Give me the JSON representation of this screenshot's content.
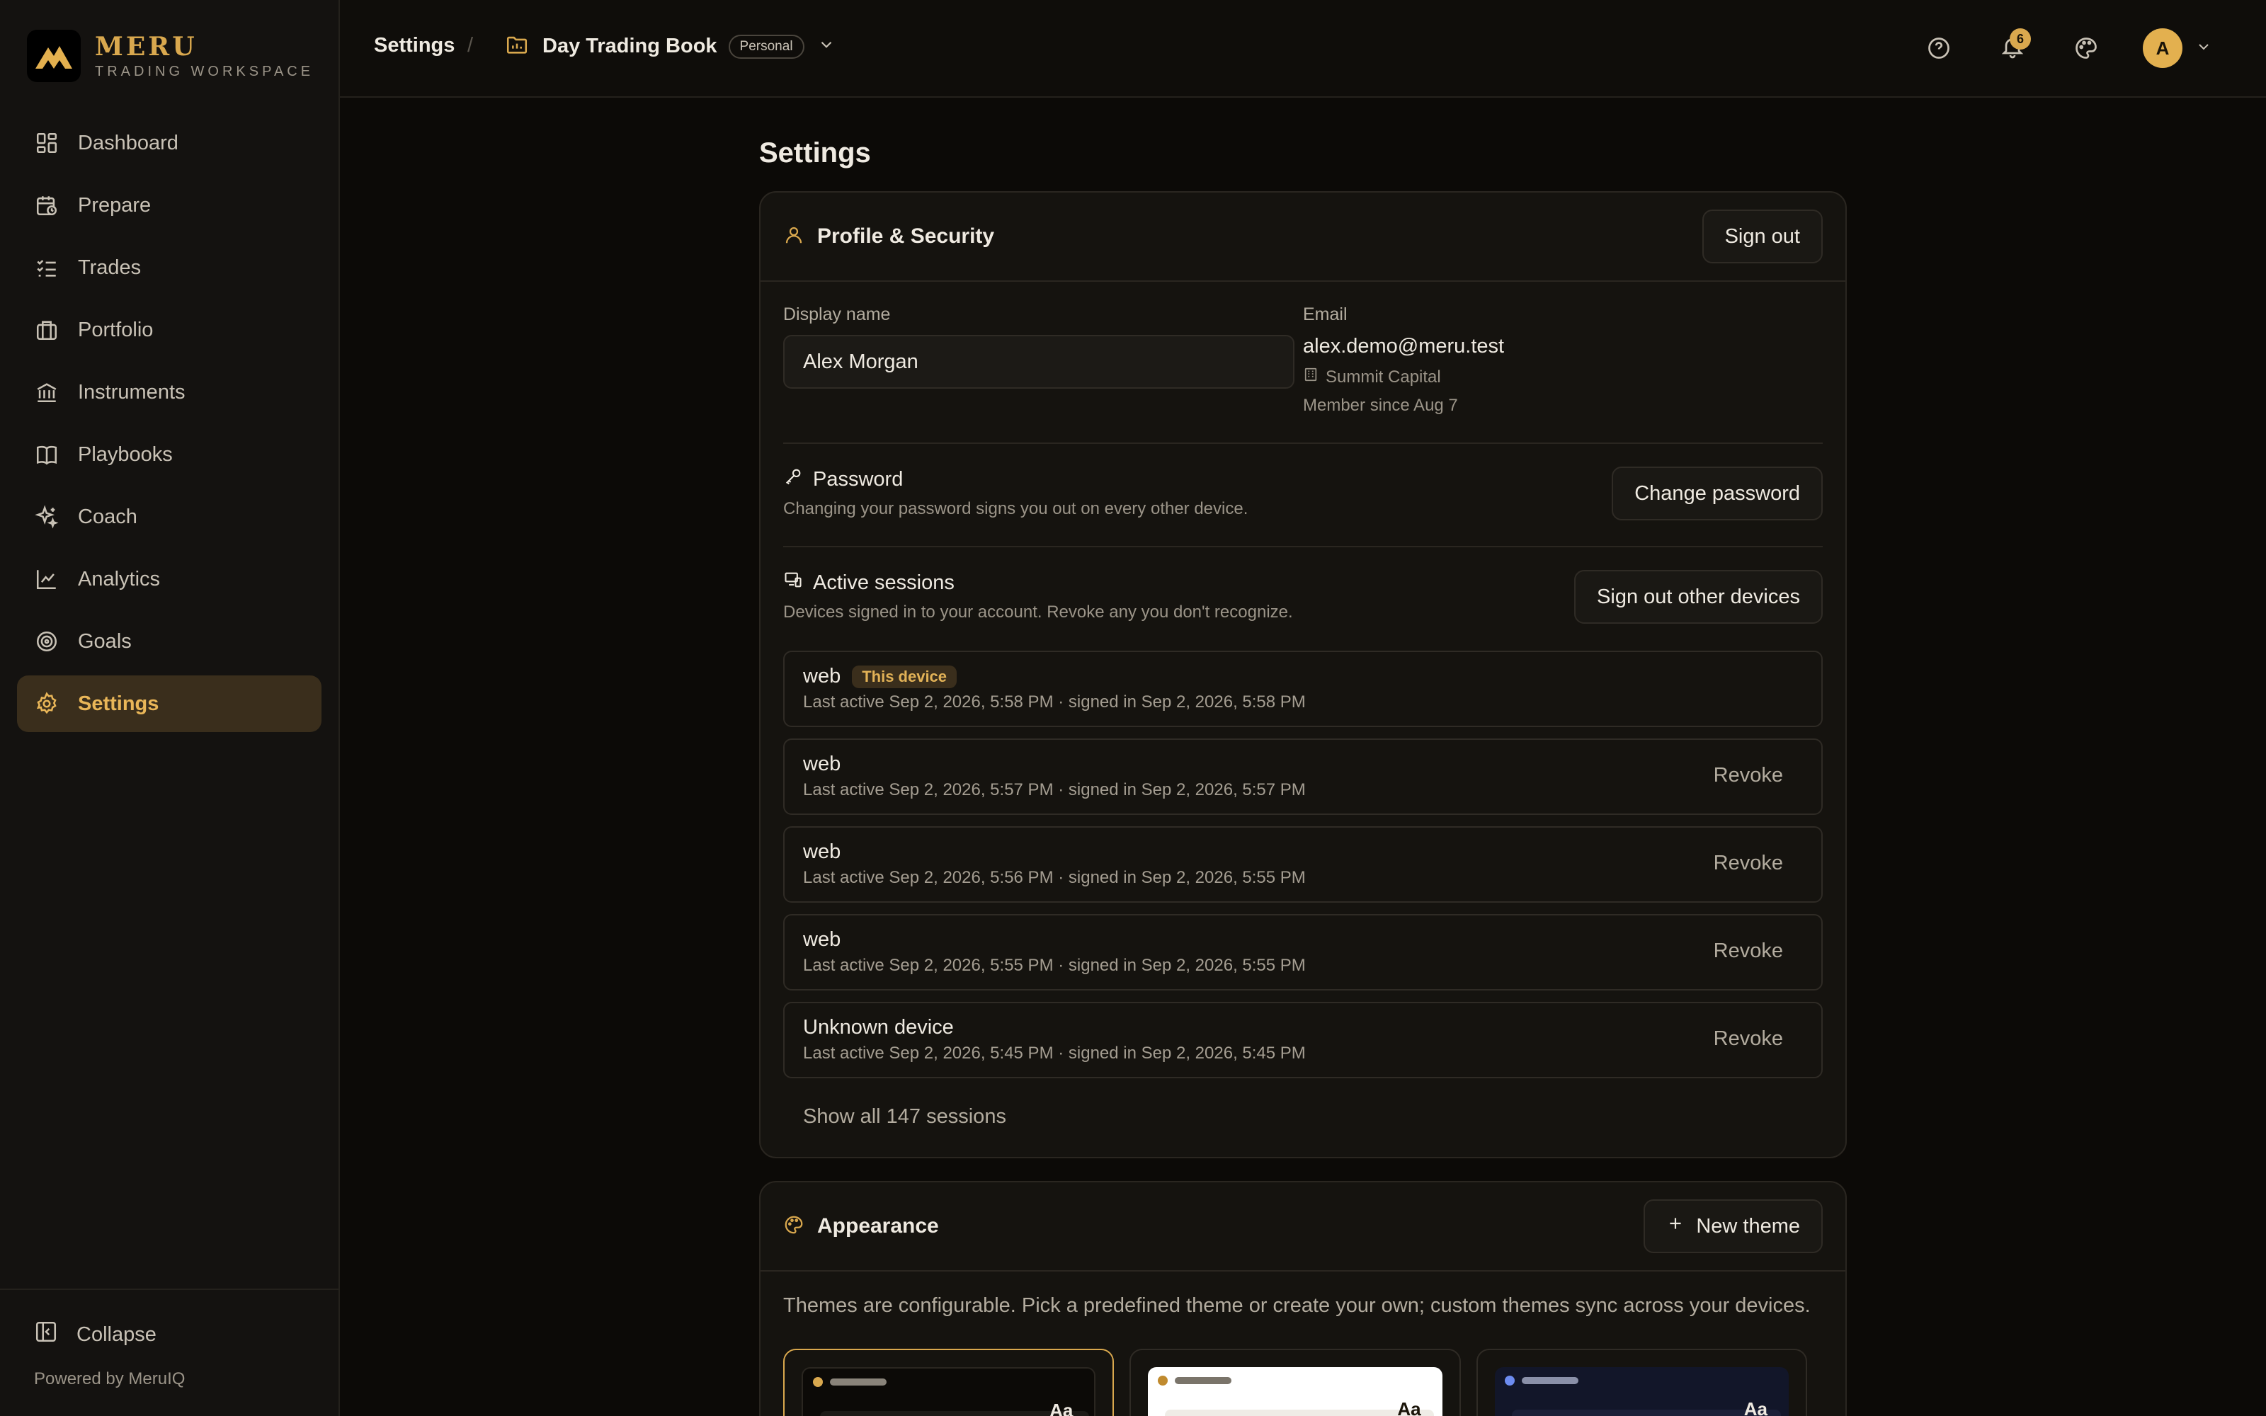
{
  "app": {
    "name": "MERU",
    "subtitle": "TRADING WORKSPACE"
  },
  "sidebar": {
    "items": [
      {
        "label": "Dashboard",
        "icon": "dashboard-icon"
      },
      {
        "label": "Prepare",
        "icon": "calendar-clock-icon"
      },
      {
        "label": "Trades",
        "icon": "list-checks-icon"
      },
      {
        "label": "Portfolio",
        "icon": "briefcase-icon"
      },
      {
        "label": "Instruments",
        "icon": "bank-icon"
      },
      {
        "label": "Playbooks",
        "icon": "book-icon"
      },
      {
        "label": "Coach",
        "icon": "sparkles-icon"
      },
      {
        "label": "Analytics",
        "icon": "line-chart-icon"
      },
      {
        "label": "Goals",
        "icon": "target-icon"
      },
      {
        "label": "Settings",
        "icon": "gear-icon",
        "active": true
      }
    ],
    "collapse_label": "Collapse",
    "powered_by": "Powered by MeruIQ"
  },
  "topbar": {
    "breadcrumb": "Settings",
    "separator": "/",
    "book_name": "Day Trading Book",
    "book_badge": "Personal",
    "notification_count": "6",
    "avatar_initial": "A"
  },
  "page": {
    "title": "Settings"
  },
  "profile": {
    "title": "Profile & Security",
    "sign_out": "Sign out",
    "display_name_label": "Display name",
    "display_name_value": "Alex Morgan",
    "email_label": "Email",
    "email_value": "alex.demo@meru.test",
    "organization": "Summit Capital",
    "member_since": "Member since Aug 7"
  },
  "password": {
    "title": "Password",
    "description": "Changing your password signs you out on every other device.",
    "button": "Change password"
  },
  "sessions": {
    "title": "Active sessions",
    "description": "Devices signed in to your account. Revoke any you don't recognize.",
    "button": "Sign out other devices",
    "this_device_tag": "This device",
    "revoke_label": "Revoke",
    "items": [
      {
        "name": "web",
        "meta": "Last active Sep 2, 2026, 5:58 PM · signed in Sep 2, 2026, 5:58 PM"
      },
      {
        "name": "web",
        "meta": "Last active Sep 2, 2026, 5:57 PM · signed in Sep 2, 2026, 5:57 PM"
      },
      {
        "name": "web",
        "meta": "Last active Sep 2, 2026, 5:56 PM · signed in Sep 2, 2026, 5:55 PM"
      },
      {
        "name": "web",
        "meta": "Last active Sep 2, 2026, 5:55 PM · signed in Sep 2, 2026, 5:55 PM"
      },
      {
        "name": "Unknown device",
        "meta": "Last active Sep 2, 2026, 5:45 PM · signed in Sep 2, 2026, 5:45 PM"
      }
    ],
    "show_all": "Show all 147 sessions"
  },
  "appearance": {
    "title": "Appearance",
    "new_theme": "New theme",
    "description": "Themes are configurable. Pick a predefined theme or create your own; custom themes sync across your devices.",
    "preview_text": "Aa"
  },
  "colors": {
    "accent": "#d9a84e",
    "background": "#0c0a07",
    "panel": "#15130f"
  }
}
